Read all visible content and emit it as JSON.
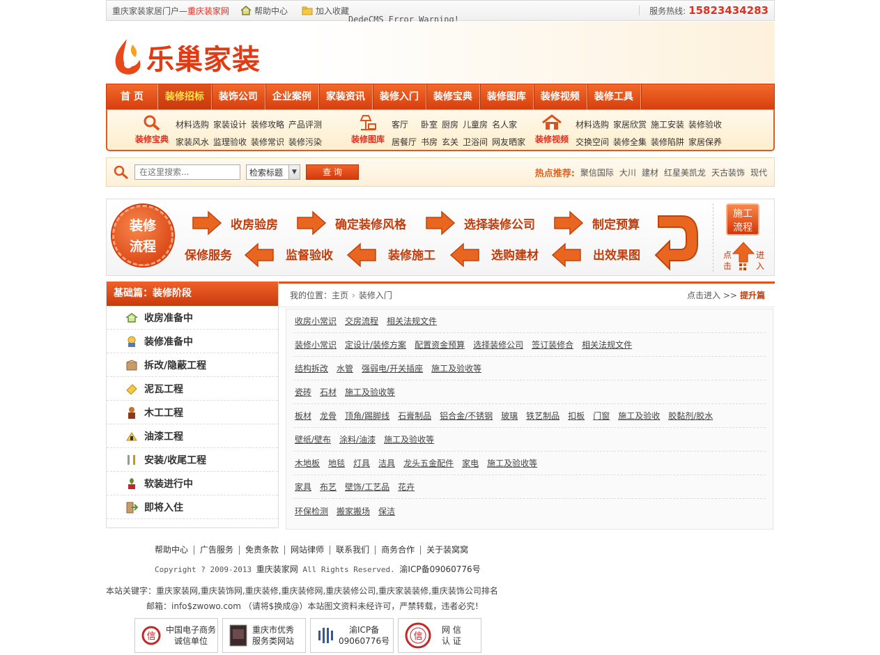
{
  "topbar": {
    "site_name": "重庆家装家居门户—",
    "site_brand": "重庆装家网",
    "help": "帮助中心",
    "favorite": "加入收藏",
    "hotline_label": "服务热线:",
    "hotline": "15823434283",
    "error_text": "DedeCMS Error Warning!"
  },
  "logo": {
    "text": "乐巢家装"
  },
  "nav": {
    "items": [
      "首 页",
      "装修招标",
      "装饰公司",
      "企业案例",
      "家装资讯",
      "装修入门",
      "装修宝典",
      "装修图库",
      "装修视频",
      "装修工具"
    ],
    "active_index": 1
  },
  "subnav": {
    "groups": [
      {
        "label": "装修宝典",
        "icon": "magnifier-icon",
        "links": [
          "材料选购",
          "家装设计",
          "装修攻略",
          "产品评测",
          "家装风水",
          "监理验收",
          "装修常识",
          "装修污染"
        ]
      },
      {
        "label": "装修图库",
        "icon": "lamp-icon",
        "links": [
          "客厅",
          "卧室",
          "厨房",
          "儿童房",
          "名人家",
          "居餐厅",
          "书房",
          "玄关",
          "卫浴间",
          "网友晒家"
        ]
      },
      {
        "label": "装修视频",
        "icon": "house-icon",
        "links": [
          "材料选购",
          "家居欣赏",
          "施工安装",
          "装修验收",
          "交换空间",
          "装修全集",
          "装修陷阱",
          "家居保养"
        ]
      }
    ]
  },
  "search": {
    "placeholder": "在这里搜索...",
    "select_value": "检索标题",
    "button": "查 询",
    "hot_label": "热点推荐:",
    "hot_items": [
      "聚信国际",
      "大川",
      "建材",
      "红星美凯龙",
      "天古装饰",
      "现代"
    ]
  },
  "process": {
    "badge_line1": "装修",
    "badge_line2": "流程",
    "steps_top": [
      "收房验房",
      "确定装修风格",
      "选择装修公司",
      "制定预算"
    ],
    "steps_bottom": [
      "出效果图",
      "选购建材",
      "装修施工",
      "监督验收",
      "保修服务"
    ],
    "side_box_line1": "施工",
    "side_box_line2": "流程",
    "side_left": "点击",
    "side_right": "进入"
  },
  "sidebar": {
    "title": "基础篇：装修阶段",
    "items": [
      {
        "label": "收房准备中",
        "icon": "house-check-icon"
      },
      {
        "label": "装修准备中",
        "icon": "worker-icon"
      },
      {
        "label": "拆改/隐蔽工程",
        "icon": "box-icon"
      },
      {
        "label": "泥瓦工程",
        "icon": "trowel-icon"
      },
      {
        "label": "木工工程",
        "icon": "carpenter-icon"
      },
      {
        "label": "油漆工程",
        "icon": "paint-roller-icon"
      },
      {
        "label": "安装/收尾工程",
        "icon": "tools-icon"
      },
      {
        "label": "软装进行中",
        "icon": "plant-icon"
      },
      {
        "label": "即将入住",
        "icon": "door-icon"
      }
    ]
  },
  "main": {
    "breadcrumb_prefix": "我的位置：",
    "breadcrumb_home": "主页",
    "breadcrumb_current": "装修入门",
    "enter_text": "点击进入 >>",
    "advanced": "提升篇",
    "rows": [
      [
        "收房小常识",
        "交房流程",
        "相关法规文件"
      ],
      [
        "装修小常识",
        "定设计/装修方案",
        "配置资金预算",
        "选择装修公司",
        "签订装修合",
        "相关法规文件"
      ],
      [
        "结构拆改",
        "水管",
        "强弱电/开关插座",
        "施工及验收等"
      ],
      [
        "瓷砖",
        "石材",
        "施工及验收等"
      ],
      [
        "板材",
        "龙骨",
        "顶角/踢脚线",
        "石膏制品",
        "铝合金/不锈钢",
        "玻璃",
        "铁艺制品",
        "扣板",
        "门窗",
        "施工及验收",
        "胶黏剂/胶水"
      ],
      [
        "壁纸/壁布",
        "涂料/油漆",
        "施工及验收等"
      ],
      [
        "木地板",
        "地毯",
        "灯具",
        "洁具",
        "龙头五金配件",
        "家电",
        "施工及验收等"
      ],
      [
        "家具",
        "布艺",
        "壁饰/工艺品",
        "花卉"
      ],
      [
        "环保检测",
        "搬家搬场",
        "保洁"
      ]
    ]
  },
  "footer": {
    "links": [
      "帮助中心",
      "广告服务",
      "免责条款",
      "网站律师",
      "联系我们",
      "商务合作",
      "关于装窝窝"
    ],
    "copyright_pre": "Copyright ? 2009-2013",
    "copyright_brand": "重庆装家网",
    "copyright_post": "All Rights Reserved.",
    "icp": "渝ICP备09060776号",
    "keywords": "本站关键字：重庆家装网,重庆装饰网,重庆装修,重庆装修网,重庆装修公司,重庆家装装修,重庆装饰公司排名",
    "mail": "邮箱：info$zwowo.com （请将$换成@）本站图文资料未经许可，严禁转载，违者必究！",
    "badges": [
      {
        "line1": "中国电子商务",
        "line2": "诚信单位"
      },
      {
        "line1": "重庆市优秀",
        "line2": "服务类网站"
      },
      {
        "line1": "渝ICP备",
        "line2": "09060776号"
      },
      {
        "line1": "网 信",
        "line2": "认 证"
      }
    ]
  }
}
